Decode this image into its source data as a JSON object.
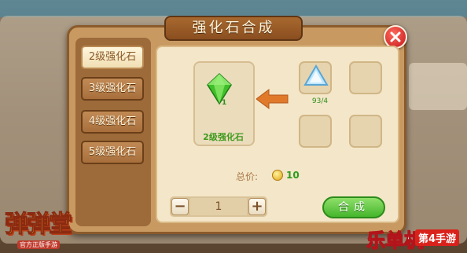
{
  "dialog": {
    "title": "强化石合成",
    "close_icon": "close-icon"
  },
  "tabs": [
    {
      "label": "2级强化石",
      "active": true
    },
    {
      "label": "3级强化石",
      "active": false
    },
    {
      "label": "4级强化石",
      "active": false
    },
    {
      "label": "5级强化石",
      "active": false
    }
  ],
  "result": {
    "name": "2级强化石",
    "count": "1",
    "icon": "green-gem-icon"
  },
  "material": {
    "count": "93/4",
    "icon": "blue-crystal-icon"
  },
  "price": {
    "label": "总价:",
    "value": "10",
    "icon": "coin-icon"
  },
  "quantity": {
    "minus": "−",
    "value": "1",
    "plus": "+"
  },
  "synth_button": "合成",
  "logos": {
    "left_title": "弹弹堂",
    "left_sub": "官方正版手游",
    "right_title": "乐单机",
    "right_tag": "第4手游"
  },
  "colors": {
    "accent_green": "#45b52c",
    "close_red": "#c4161b",
    "wood": "#8b5a2b"
  }
}
